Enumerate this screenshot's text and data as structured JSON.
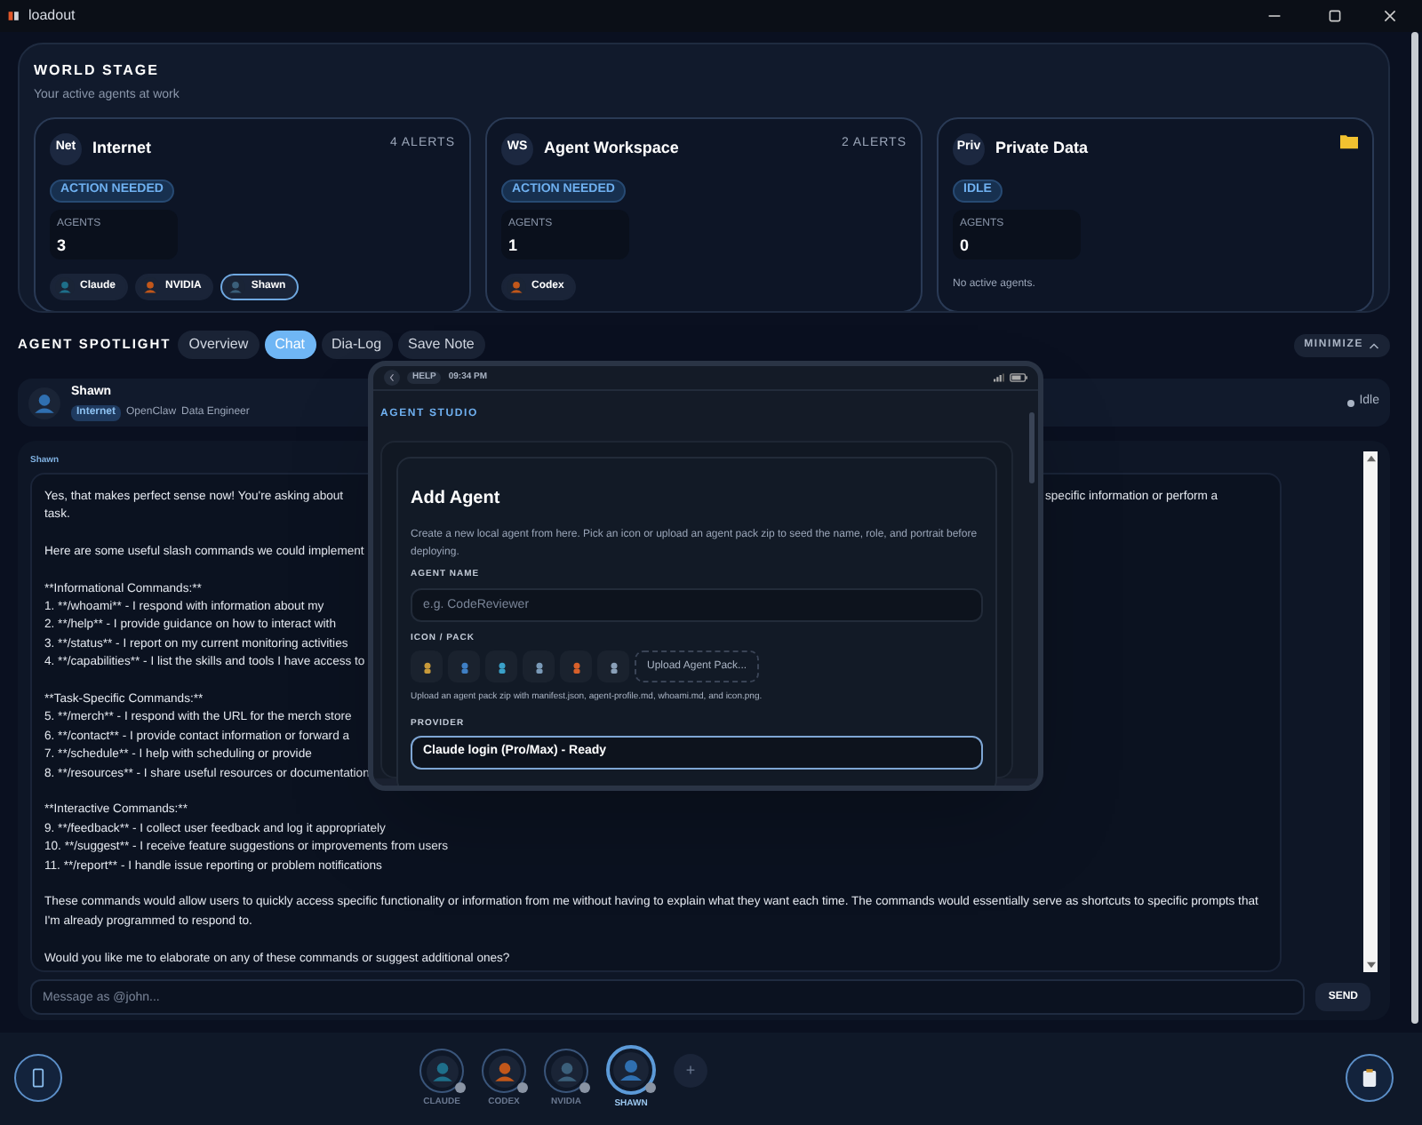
{
  "window": {
    "title": "loadout"
  },
  "world_stage": {
    "title": "WORLD STAGE",
    "subtitle": "Your active agents at work",
    "zones": [
      {
        "badge": "Net",
        "name": "Internet",
        "alerts": "4 ALERTS",
        "status": "ACTION NEEDED",
        "agents_label": "AGENTS",
        "agents_count": "3",
        "folder": false,
        "agents": [
          {
            "name": "Claude",
            "selected": false
          },
          {
            "name": "NVIDIA",
            "selected": false
          },
          {
            "name": "Shawn",
            "selected": true
          }
        ]
      },
      {
        "badge": "WS",
        "name": "Agent Workspace",
        "alerts": "2 ALERTS",
        "status": "ACTION NEEDED",
        "agents_label": "AGENTS",
        "agents_count": "1",
        "folder": false,
        "agents": [
          {
            "name": "Codex",
            "selected": false
          }
        ]
      },
      {
        "badge": "Priv",
        "name": "Private Data",
        "status": "IDLE",
        "agents_label": "AGENTS",
        "agents_count": "0",
        "folder": true,
        "empty_text": "No active agents."
      }
    ]
  },
  "spotlight": {
    "title": "AGENT SPOTLIGHT",
    "minimize": "MINIMIZE",
    "tabs": [
      {
        "label": "Overview",
        "selected": false
      },
      {
        "label": "Chat",
        "selected": true
      },
      {
        "label": "Dia-Log",
        "selected": false
      },
      {
        "label": "Save Note",
        "selected": false
      }
    ],
    "agent": {
      "name": "Shawn",
      "zone": "Internet",
      "tags": [
        "OpenClaw",
        "Data Engineer"
      ],
      "status": "Idle"
    },
    "chat": {
      "sender": "Shawn",
      "paragraphs": [
        {
          "lines": [
            {
              "text": "Yes, that makes perfect sense now! You're asking about",
              "right": "specific information or perform a"
            },
            {
              "text": "task."
            }
          ]
        },
        {
          "lines": [
            {
              "text": "Here are some useful slash commands we could implement"
            }
          ]
        },
        {
          "lines": [
            {
              "text": "**Informational Commands:**"
            },
            {
              "text": "1. **/whoami** - I respond with information about my"
            },
            {
              "text": "2. **/help** - I provide guidance on how to interact with"
            },
            {
              "text": "3. **/status** - I report on my current monitoring activities"
            },
            {
              "text": "4. **/capabilities** - I list the skills and tools I have access to"
            }
          ]
        },
        {
          "lines": [
            {
              "text": "**Task-Specific Commands:**"
            },
            {
              "text": "5. **/merch** - I respond with the URL for the merch store"
            },
            {
              "text": "6. **/contact** - I provide contact information or forward a"
            },
            {
              "text": "7. **/schedule** - I help with scheduling or provide"
            },
            {
              "text": "8. **/resources** - I share useful resources or documentation"
            }
          ]
        },
        {
          "lines": [
            {
              "text": "**Interactive Commands:**"
            },
            {
              "text": "9. **/feedback** - I collect user feedback and log it appropriately"
            },
            {
              "text": "10. **/suggest** - I receive feature suggestions or improvements from users"
            },
            {
              "text": "11. **/report** - I handle issue reporting or problem notifications"
            }
          ]
        },
        {
          "lines": [
            {
              "text": "These commands would allow users to quickly access specific functionality or information from me without having to explain what they want each time. The commands would essentially serve as shortcuts to specific prompts that I'm already programmed to respond to."
            }
          ]
        },
        {
          "lines": [
            {
              "text": "Would you like me to elaborate on any of these commands or suggest additional ones?"
            }
          ]
        }
      ],
      "placeholder": "Message as @john...",
      "send": "SEND"
    }
  },
  "dock": {
    "agents": [
      {
        "name": "CLAUDE",
        "selected": false
      },
      {
        "name": "CODEX",
        "selected": false
      },
      {
        "name": "NVIDIA",
        "selected": false
      },
      {
        "name": "SHAWN",
        "selected": true
      }
    ],
    "add": "+"
  },
  "studio": {
    "help": "HELP",
    "time": "09:34 PM",
    "section": "AGENT STUDIO",
    "title": "Add Agent",
    "description": "Create a new local agent from here. Pick an icon or upload an agent pack zip to seed the name, role, and portrait before deploying.",
    "name_label": "AGENT NAME",
    "name_placeholder": "e.g. CodeReviewer",
    "icon_label": "ICON / PACK",
    "upload": "Upload Agent Pack...",
    "hint": "Upload an agent pack zip with manifest.json, agent-profile.md, whoami.md, and icon.png.",
    "provider_label": "PROVIDER",
    "provider_value": "Claude login (Pro/Max) - Ready"
  }
}
